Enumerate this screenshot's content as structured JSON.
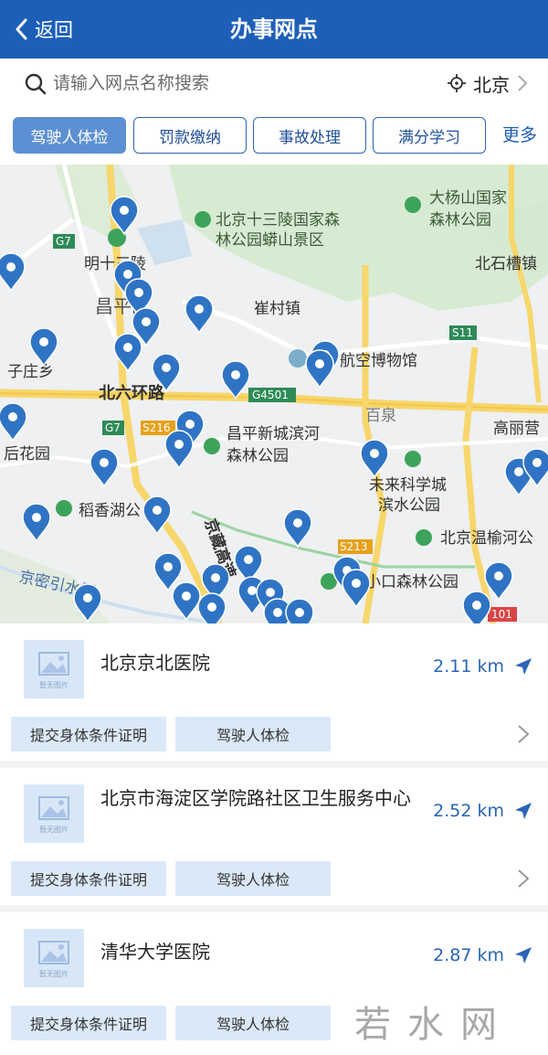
{
  "header": {
    "back_label": "返回",
    "title": "办事网点"
  },
  "search": {
    "placeholder": "请输入网点名称搜索",
    "city": "北京"
  },
  "filters": {
    "tabs": [
      "驾驶人体检",
      "罚款缴纳",
      "事故处理",
      "满分学习"
    ],
    "active": "驾驶人体检",
    "more": "更多"
  },
  "map": {
    "labels": [
      "北京十三陵国家森",
      "林公园蟒山景区",
      "大杨山国家",
      "森林公园",
      "明十三陵",
      "北石槽镇",
      "昌平区",
      "崔村镇",
      "航空博物馆",
      "北六环路",
      "G4501",
      "G7",
      "S11",
      "S216",
      "子庄乡",
      "昌平新城滨河",
      "森林公园",
      "百泉",
      "高丽营",
      "后花园",
      "未来科学城",
      "滨水公园",
      "稻香湖公",
      "北京温榆河公",
      "京藏高速",
      "S213",
      "小口森林公园",
      "京密引水渠",
      "101"
    ]
  },
  "list": [
    {
      "thumb_caption": "暂无图片",
      "name": "北京京北医院",
      "distance": "2.11 km",
      "tags": [
        "提交身体条件证明",
        "驾驶人体检"
      ]
    },
    {
      "thumb_caption": "暂无图片",
      "name": "北京市海淀区学院路社区卫生服务中心",
      "distance": "2.52 km",
      "tags": [
        "提交身体条件证明",
        "驾驶人体检"
      ]
    },
    {
      "thumb_caption": "暂无图片",
      "name": "清华大学医院",
      "distance": "2.87 km",
      "tags": [
        "提交身体条件证明",
        "驾驶人体检"
      ]
    }
  ],
  "watermark": "若水网",
  "colors": {
    "header": "#1d5fb8",
    "accent": "#2a64b6",
    "pin": "#2f74c4",
    "tag_bg": "#dbe8f7"
  }
}
